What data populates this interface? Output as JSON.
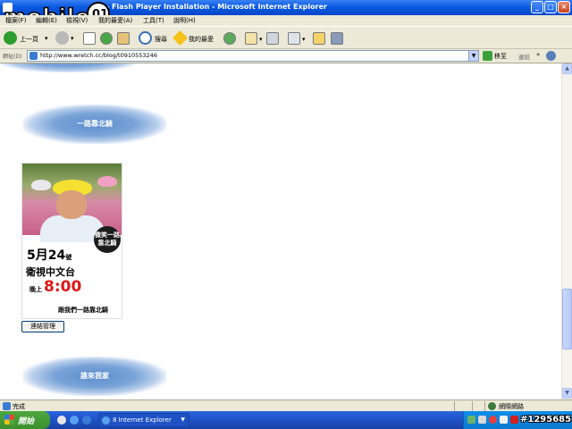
{
  "window": {
    "title": "···· - Flash Player Installation - Microsoft Internet Explorer",
    "controls": {
      "minimize": "_",
      "maximize": "□",
      "close": "×"
    }
  },
  "logo": {
    "text": "mobile01"
  },
  "menu": {
    "items": [
      "檔案(F)",
      "編輯(E)",
      "檢視(V)",
      "我的最愛(A)",
      "工具(T)",
      "說明(H)"
    ]
  },
  "toolbar": {
    "back_label": "上一頁",
    "search_label": "搜尋",
    "favorites_label": "我的最愛"
  },
  "address": {
    "label": "網址(D)",
    "url": "http://www.wretch.cc/blog/t0910553246",
    "go_label": "移至",
    "links_label": "連結",
    "more": "»"
  },
  "content": {
    "cloud_top_title": "一路靠北騎",
    "cloud_bottom_title": "誰來我家",
    "poster": {
      "badge": "微笑一路靠北騎",
      "date_month": "5月",
      "date_day": "24",
      "date_suffix": "號",
      "channel": "衛視中文台",
      "time_prefix": "晚上",
      "time": "8:00",
      "slogan": "跟我們一路靠北騎"
    },
    "manage_button": "連結管理"
  },
  "statusbar": {
    "status": "完成",
    "zone": "網際網路"
  },
  "taskbar": {
    "start_label": "開始",
    "task_label": "8 Internet Explorer",
    "task_arrow": "▼"
  },
  "watermark": "#1295685"
}
